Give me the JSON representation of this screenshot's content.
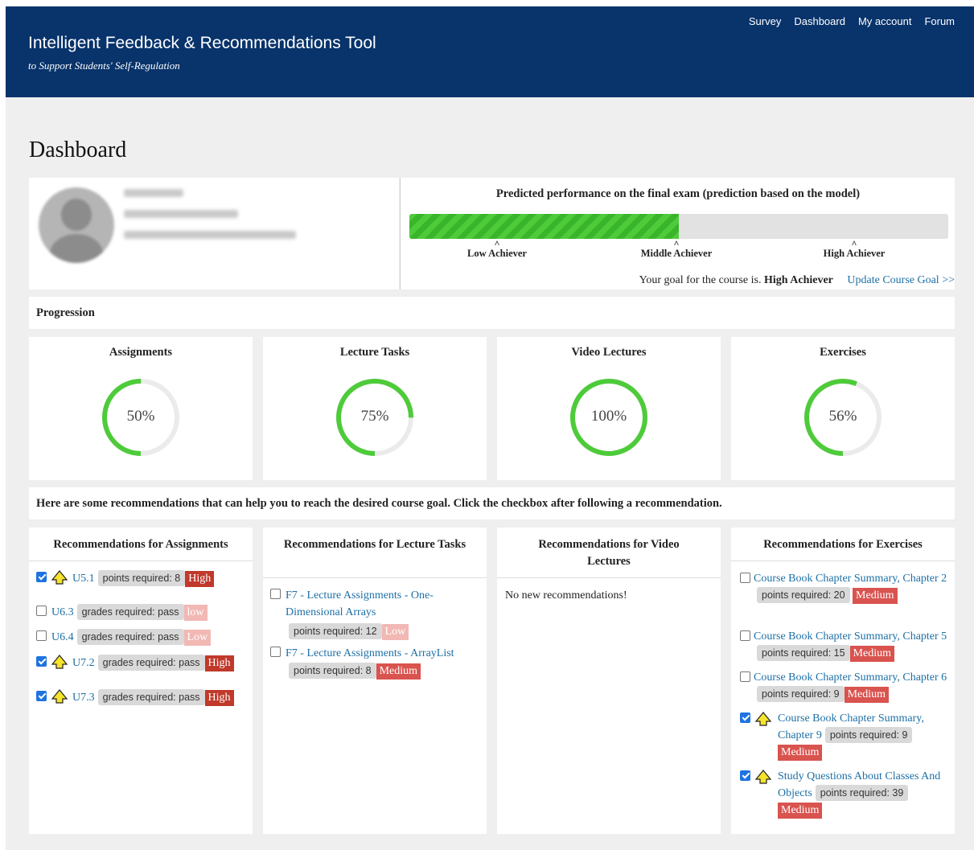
{
  "header": {
    "title": "Intelligent Feedback & Recommendations Tool",
    "subtitle": "to Support Students' Self-Regulation",
    "nav": [
      "Survey",
      "Dashboard",
      "My account",
      "Forum"
    ]
  },
  "page_title": "Dashboard",
  "prediction": {
    "title": "Predicted performance on the final exam (prediction based on the model)",
    "fill_fraction": 0.5,
    "markers": [
      "Low Achiever",
      "Middle Achiever",
      "High Achiever"
    ],
    "goal_prefix": "Your goal for the course is.",
    "goal_value": "High Achiever",
    "update_link": "Update Course Goal >>"
  },
  "progression": {
    "label": "Progression",
    "items": [
      {
        "title": "Assignments",
        "percent": 50,
        "text": "50%"
      },
      {
        "title": "Lecture Tasks",
        "percent": 75,
        "text": "75%"
      },
      {
        "title": "Video Lectures",
        "percent": 100,
        "text": "100%"
      },
      {
        "title": "Exercises",
        "percent": 56,
        "text": "56%"
      }
    ]
  },
  "info_text": "Here are some recommendations that can help you to reach the desired course goal. Click the checkbox after following a recommendation.",
  "recommendations": {
    "assignments": {
      "title": "Recommendations for Assignments",
      "items": [
        {
          "label": "U5.1",
          "req": "points required: 8",
          "priority": "High",
          "checked": true,
          "warn": true
        },
        {
          "label": "U6.3",
          "req": "grades required: pass",
          "priority": "low",
          "checked": false,
          "warn": false
        },
        {
          "label": "U6.4",
          "req": "grades required: pass",
          "priority": "Low",
          "checked": false,
          "warn": false
        },
        {
          "label": "U7.2",
          "req": "grades required: pass",
          "priority": "High",
          "checked": true,
          "warn": true
        },
        {
          "label": "U7.3",
          "req": "grades required: pass",
          "priority": "High",
          "checked": true,
          "warn": true
        }
      ]
    },
    "lecture_tasks": {
      "title": "Recommendations for Lecture Tasks",
      "items": [
        {
          "label": "F7 - Lecture Assignments - One-Dimensional Arrays",
          "req": "points required: 12",
          "priority": "Low",
          "checked": false
        },
        {
          "label": "F7 - Lecture Assignments - ArrayList",
          "req": "points required: 8",
          "priority": "Medium",
          "checked": false
        }
      ]
    },
    "video_lectures": {
      "title": "Recommendations for Video Lectures",
      "empty_text": "No new recommendations!"
    },
    "exercises": {
      "title": "Recommendations for Exercises",
      "items": [
        {
          "label": "Course Book Chapter Summary, Chapter 2",
          "req": "points required: 20",
          "priority": "Medium",
          "checked": false,
          "warn": false
        },
        {
          "label": "Course Book Chapter Summary, Chapter 5",
          "req": "points required: 15",
          "priority": "Medium",
          "checked": false,
          "warn": false
        },
        {
          "label": "Course Book Chapter Summary, Chapter 6",
          "req": "points required: 9",
          "priority": "Medium",
          "checked": false,
          "warn": false
        },
        {
          "label": "Course Book Chapter Summary, Chapter 9",
          "req": "points required: 9",
          "priority": "Medium",
          "checked": true,
          "warn": true
        },
        {
          "label": "Study Questions About Classes And Objects",
          "req": "points required: 39",
          "priority": "Medium",
          "checked": true,
          "warn": true
        }
      ]
    }
  },
  "colors": {
    "header_bg": "#08336b",
    "page_bg": "#efefef",
    "progress_green": "#4ecb3a",
    "link": "#1d6fa5",
    "priority_high": "#c0392b",
    "priority_medium": "#d9534f",
    "priority_low": "#f2b8b4"
  }
}
